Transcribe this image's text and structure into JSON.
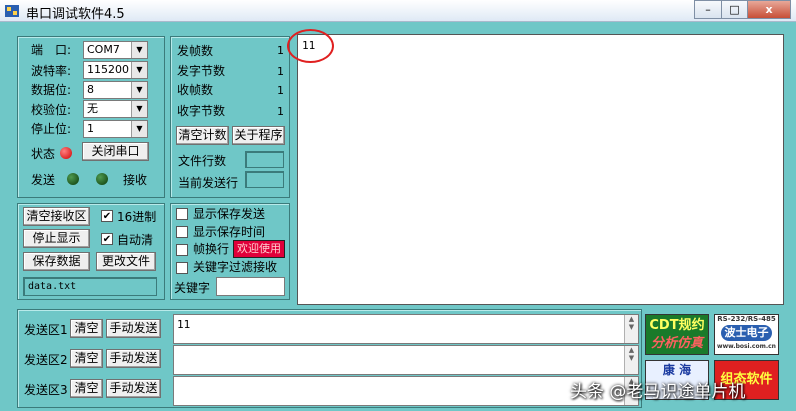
{
  "window": {
    "title": "串口调试软件4.5",
    "min_glyph": "–",
    "max_glyph": "□",
    "close_glyph": "x"
  },
  "serial": {
    "port_label": "端　口:",
    "port_value": "COM7",
    "baud_label": "波特率:",
    "baud_value": "115200",
    "databits_label": "数据位:",
    "databits_value": "8",
    "parity_label": "校验位:",
    "parity_value": "无",
    "stopbits_label": "停止位:",
    "stopbits_value": "1",
    "status_label": "状态",
    "close_port_button": "关闭串口",
    "send_label": "发送",
    "recv_label": "接收"
  },
  "counters": {
    "send_frames_label": "发帧数",
    "send_frames_value": "1",
    "send_bytes_label": "发字节数",
    "send_bytes_value": "1",
    "recv_frames_label": "收帧数",
    "recv_frames_value": "1",
    "recv_bytes_label": "收字节数",
    "recv_bytes_value": "1",
    "clear_count_button": "清空计数",
    "about_button": "关于程序",
    "file_lines_label": "文件行数",
    "current_line_label": "当前发送行"
  },
  "receive_controls": {
    "clear_recv_button": "清空接收区",
    "hex_label": "16进制",
    "stop_display_button": "停止显示",
    "auto_clear_label": "自动清",
    "save_data_button": "保存数据",
    "change_file_button": "更改文件",
    "filename": "data.txt"
  },
  "options": {
    "show_save_send": "显示保存发送",
    "show_save_time": "显示保存时间",
    "frame_newline": "帧换行",
    "welcome_badge": "欢迎使用",
    "keyword_filter": "关键字过滤接收",
    "keyword_label": "关键字"
  },
  "receive_area": {
    "text": "11"
  },
  "send_areas": [
    {
      "label": "发送区1",
      "clear": "清空",
      "manual": "手动发送",
      "text": "11"
    },
    {
      "label": "发送区2",
      "clear": "清空",
      "manual": "手动发送",
      "text": ""
    },
    {
      "label": "发送区3",
      "clear": "清空",
      "manual": "手动发送",
      "text": ""
    }
  ],
  "logos": {
    "cdt_line1": "CDT规约",
    "cdt_line2": "分析仿真",
    "bosi_line1": "RS-232/RS-485",
    "bosi_line2": "波士电子",
    "bosi_line3": "www.bosi.com.cn",
    "kanghai": "康 海",
    "zutai": "组态软件"
  },
  "watermark": "头条 @老马识途单片机",
  "colors": {
    "background": "#6fc7c7",
    "led_red": "#d00000",
    "welcome_bg": "#e0003a",
    "annotation_red": "#e02020"
  }
}
